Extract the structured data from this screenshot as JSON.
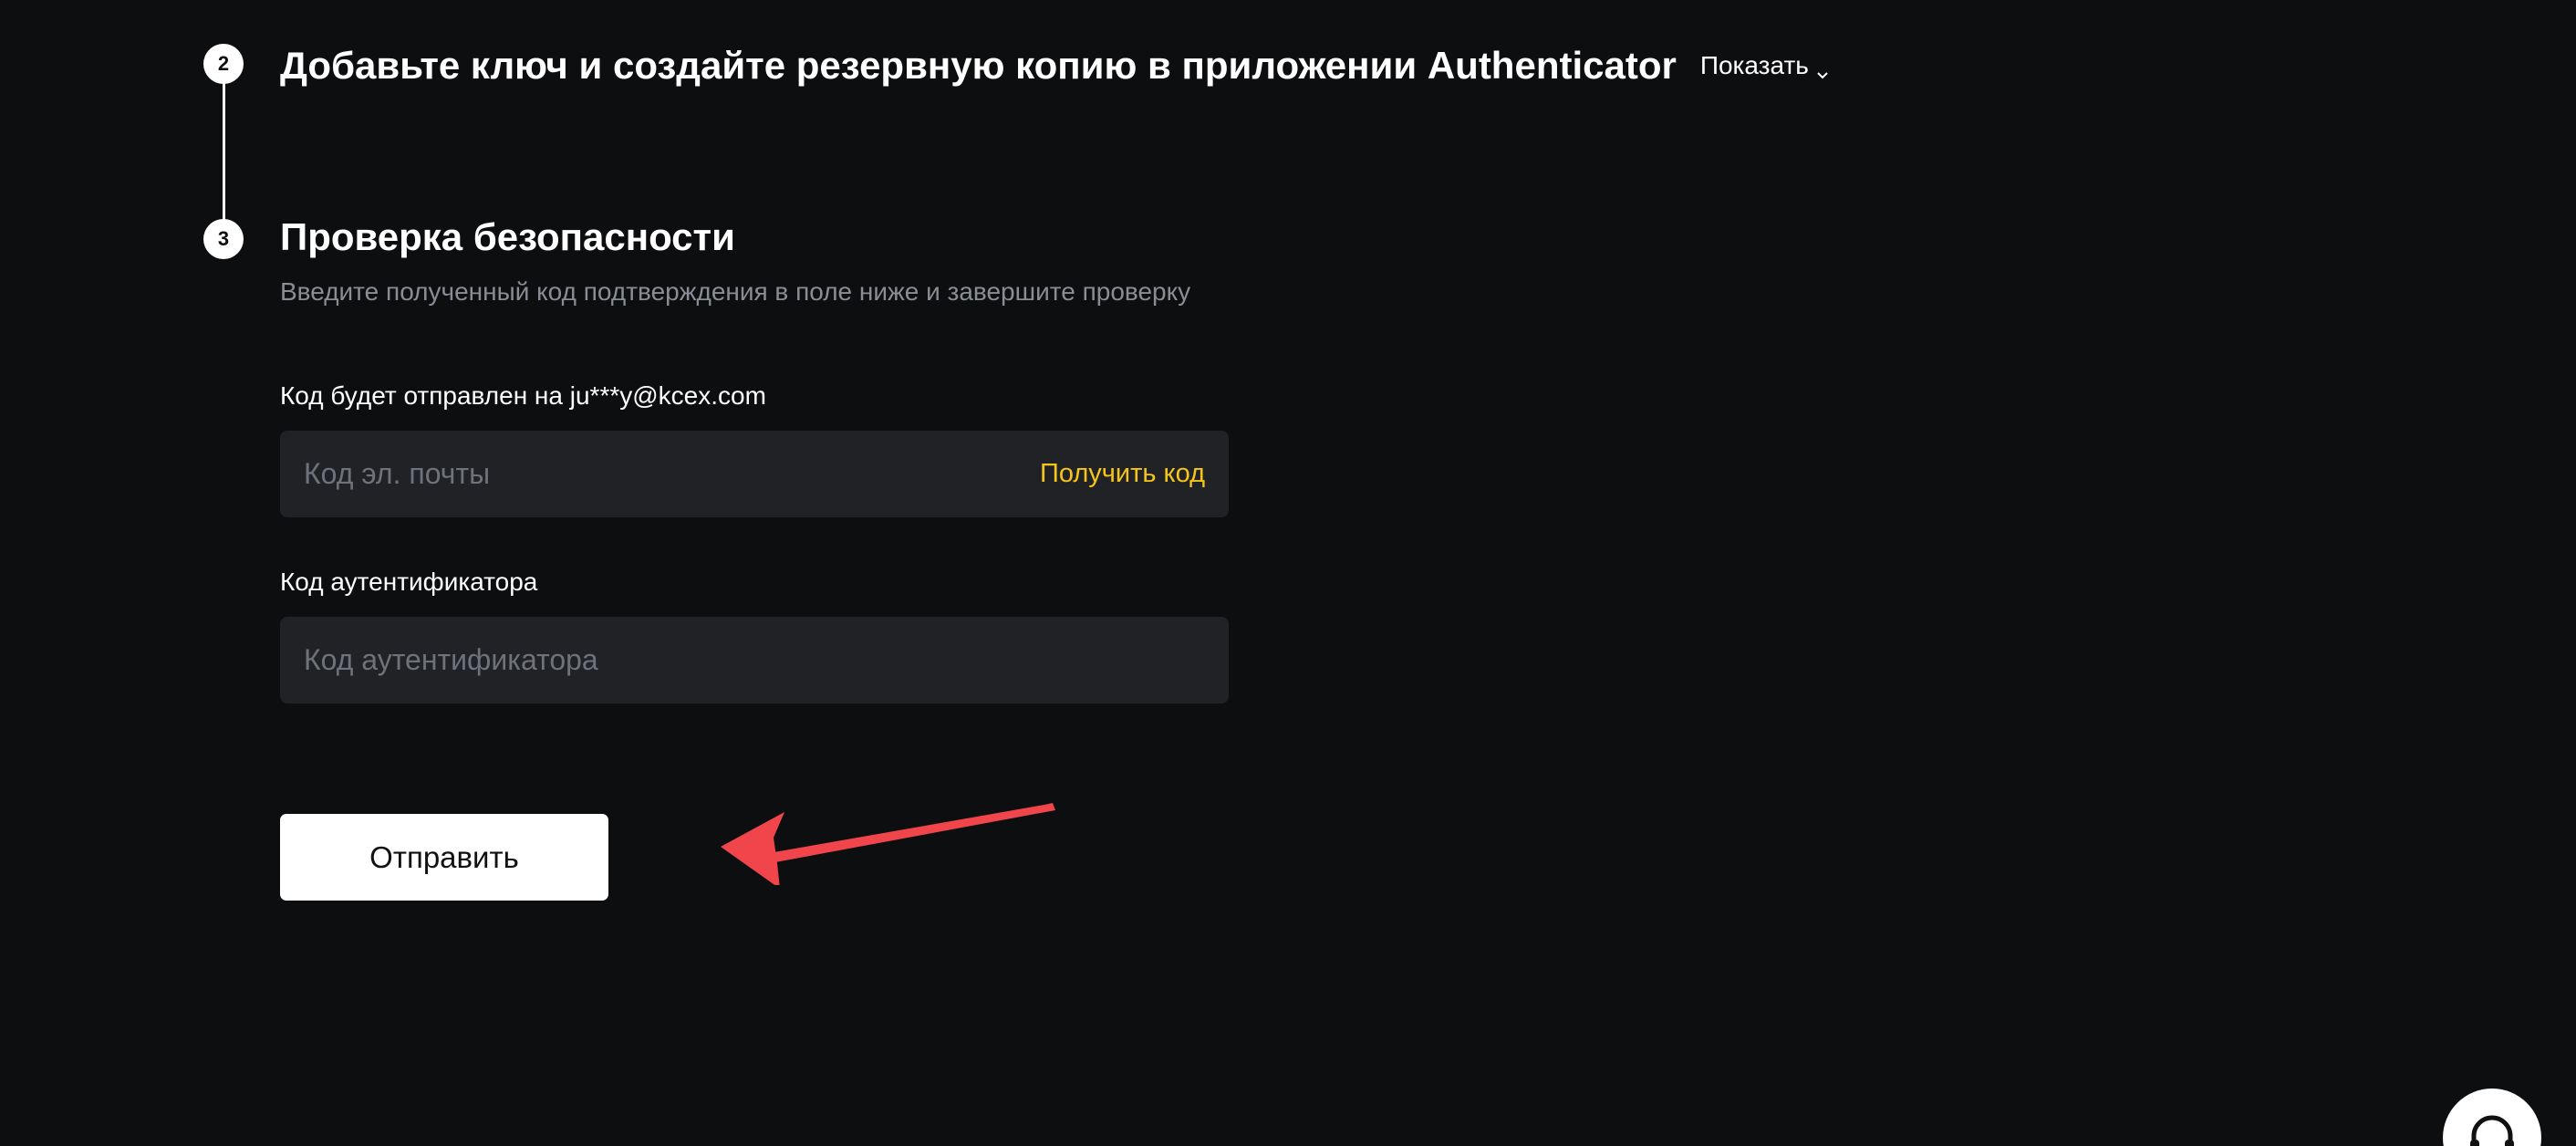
{
  "step2": {
    "number": "2",
    "title": "Добавьте ключ и создайте резервную копию в приложении Authenticator",
    "show_label": "Показать"
  },
  "step3": {
    "number": "3",
    "title": "Проверка безопасности",
    "subtitle": "Введите полученный код подтверждения в поле ниже и завершите проверку"
  },
  "email_code": {
    "label": "Код будет отправлен на ju***y@kcex.com",
    "placeholder": "Код эл. почты",
    "get_code_label": "Получить код"
  },
  "auth_code": {
    "label": "Код аутентификатора",
    "placeholder": "Код аутентификатора"
  },
  "submit": {
    "label": "Отправить"
  },
  "icons": {
    "show_toggle": "chevron-down-icon",
    "annotation": "red-arrow-icon",
    "support": "headset-icon"
  },
  "colors": {
    "background": "#0d0e10",
    "input_background": "#212226",
    "accent_link": "#f5c518",
    "annotation_arrow": "#f0454b",
    "muted_text": "#8a8d95"
  }
}
